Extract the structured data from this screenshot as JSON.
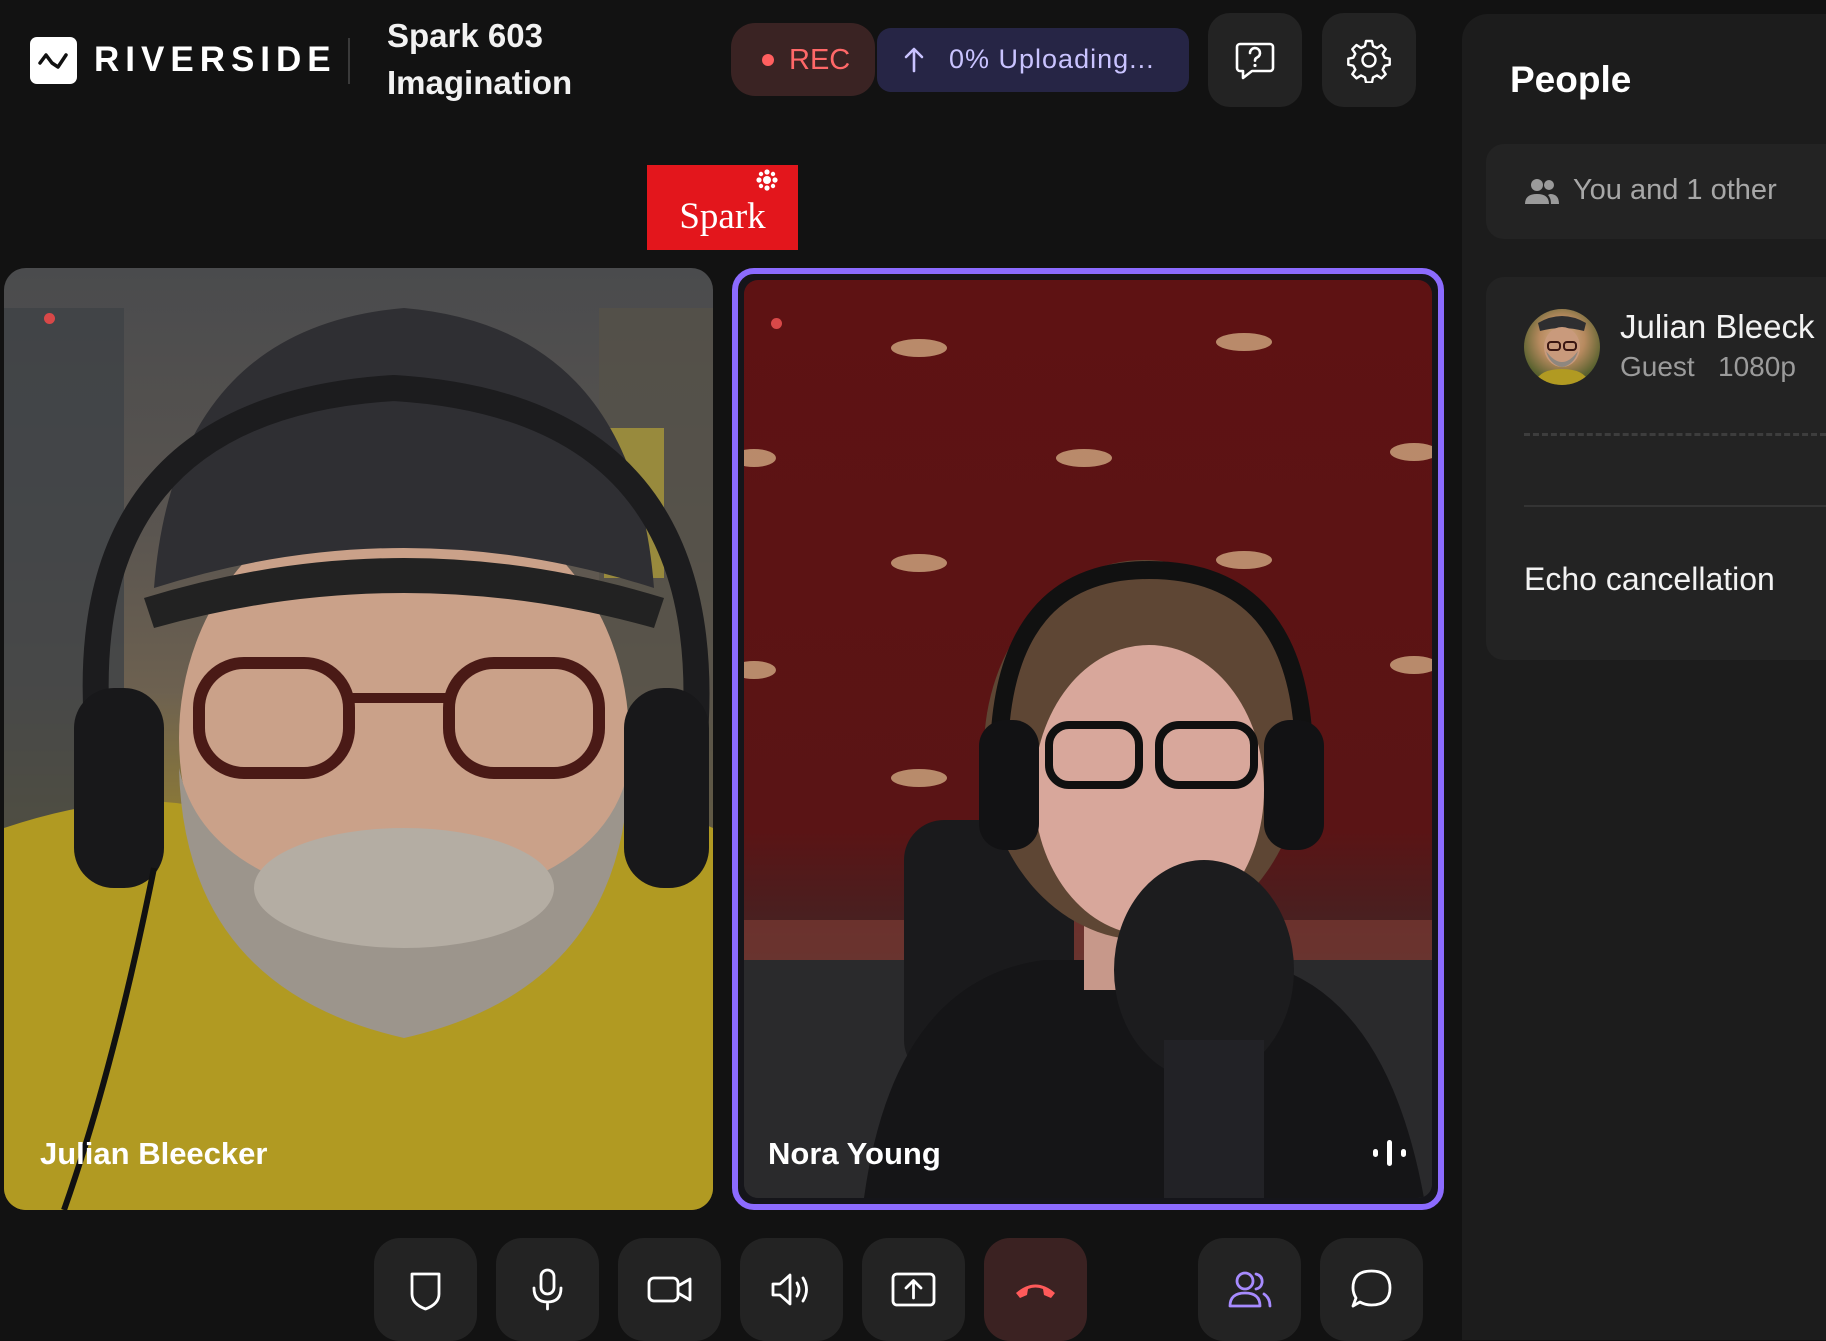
{
  "header": {
    "brand": "RIVERSIDE",
    "title_line1": "Spark 603",
    "title_line2": "Imagination",
    "rec_label": "REC",
    "upload_label": "0% Uploading...",
    "icons": [
      "help-icon",
      "settings-icon"
    ]
  },
  "overlay": {
    "show_logo_text": "Spark"
  },
  "tiles": [
    {
      "name": "Julian Bleecker"
    },
    {
      "name": "Nora Young"
    }
  ],
  "controls": [
    "shield-icon",
    "mic-icon",
    "camera-icon",
    "speaker-icon",
    "share-screen-icon",
    "end-call-icon",
    "people-icon",
    "chat-icon"
  ],
  "people_panel": {
    "title": "People",
    "summary": "You and 1 other",
    "person": {
      "name": "Julian Bleeck",
      "meta": "Guest   1080p"
    },
    "echo_label": "Echo cancellation"
  },
  "colors": {
    "accent": "#8c6bff",
    "rec": "#ff6868",
    "end_call": "#ff5a5a",
    "spark_red": "#e3161c"
  }
}
